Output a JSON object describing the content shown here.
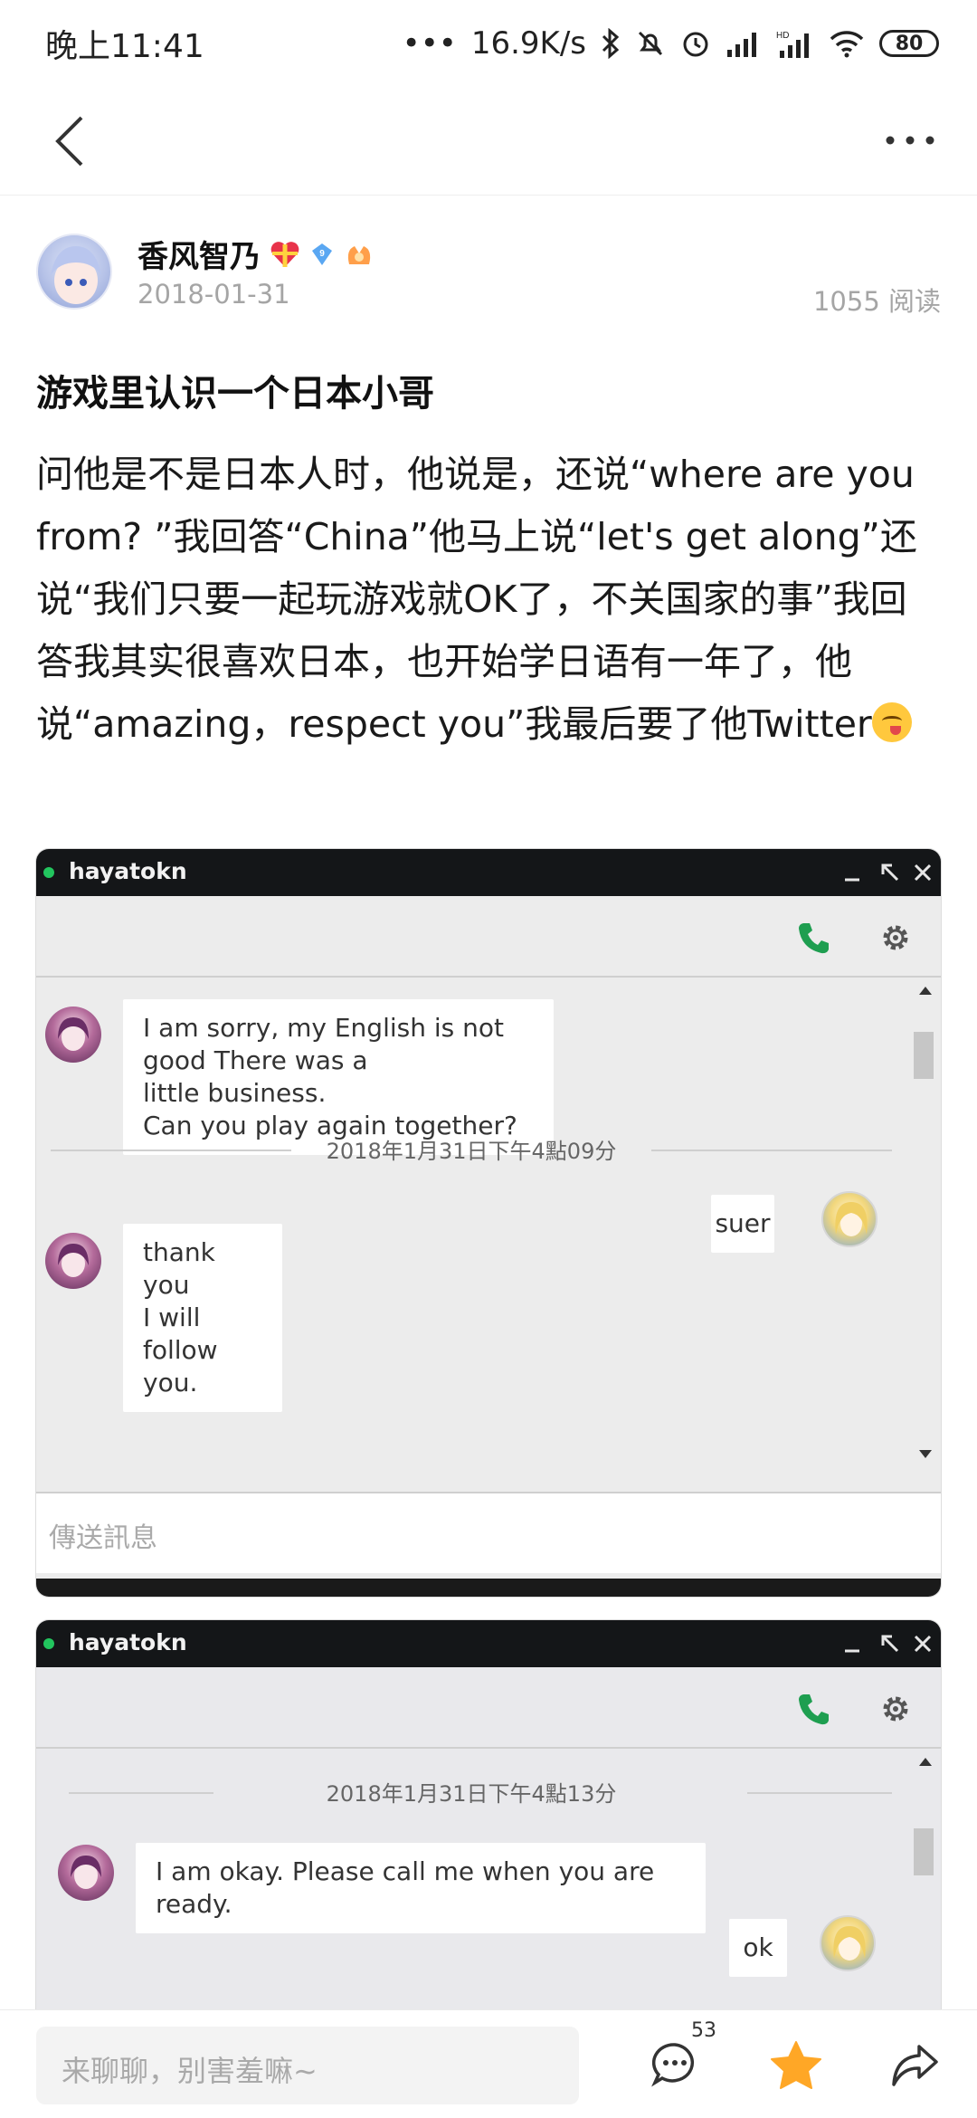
{
  "status_bar": {
    "time": "晚上11:41",
    "net_speed": "16.9K/s",
    "battery": "80"
  },
  "author": {
    "name": "香风智乃",
    "date": "2018-01-31",
    "read_count": "1055 阅读",
    "level_badge": "9"
  },
  "post": {
    "title": "游戏里认识一个日本小哥",
    "body": "问他是不是日本人时，他说是，还说“where are you from? ”我回答“China”他马上说“let's get along”还说“我们只要一起玩游戏就OK了，不关国家的事”我回答我其实很喜欢日本，也开始学日语有一年了，他说“amazing，respect you”我最后要了他Twitter"
  },
  "chat1": {
    "username": "hayatokn",
    "msg1": "I am sorry, my English is not good There was a\nlittle business.\nCan you play again together?",
    "timestamp": "2018年1月31日下午4點09分",
    "reply1": "suer",
    "msg2": "thank you\nI will follow you.",
    "compose_placeholder": "傳送訊息"
  },
  "chat2": {
    "username": "hayatokn",
    "timestamp": "2018年1月31日下午4點13分",
    "msg1": "I am okay. Please call me when you are ready.",
    "reply1": "ok"
  },
  "bottom_bar": {
    "comment_placeholder": "来聊聊，别害羞嘛~",
    "comment_count": "53"
  },
  "colors": {
    "accent_star": "#ffa726",
    "online": "#22c55e",
    "call_green": "#1e9e50"
  }
}
